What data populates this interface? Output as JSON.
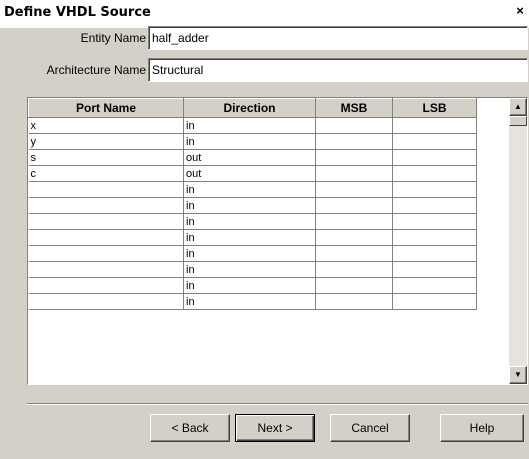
{
  "window": {
    "title": "Define VHDL Source",
    "close_glyph": "×"
  },
  "form": {
    "entity_label": "Entity Name",
    "entity_value": "half_adder",
    "architecture_label": "Architecture Name",
    "architecture_value": "Structural"
  },
  "table": {
    "columns": [
      "Port Name",
      "Direction",
      "MSB",
      "LSB"
    ],
    "rows": [
      [
        "x",
        "in",
        "",
        ""
      ],
      [
        "y",
        "in",
        "",
        ""
      ],
      [
        "s",
        "out",
        "",
        ""
      ],
      [
        "c",
        "out",
        "",
        ""
      ],
      [
        "",
        "in",
        "",
        ""
      ],
      [
        "",
        "in",
        "",
        ""
      ],
      [
        "",
        "in",
        "",
        ""
      ],
      [
        "",
        "in",
        "",
        ""
      ],
      [
        "",
        "in",
        "",
        ""
      ],
      [
        "",
        "in",
        "",
        ""
      ],
      [
        "",
        "in",
        "",
        ""
      ],
      [
        "",
        "in",
        "",
        ""
      ]
    ]
  },
  "buttons": {
    "back": "< Back",
    "next": "Next >",
    "cancel": "Cancel",
    "help": "Help"
  }
}
